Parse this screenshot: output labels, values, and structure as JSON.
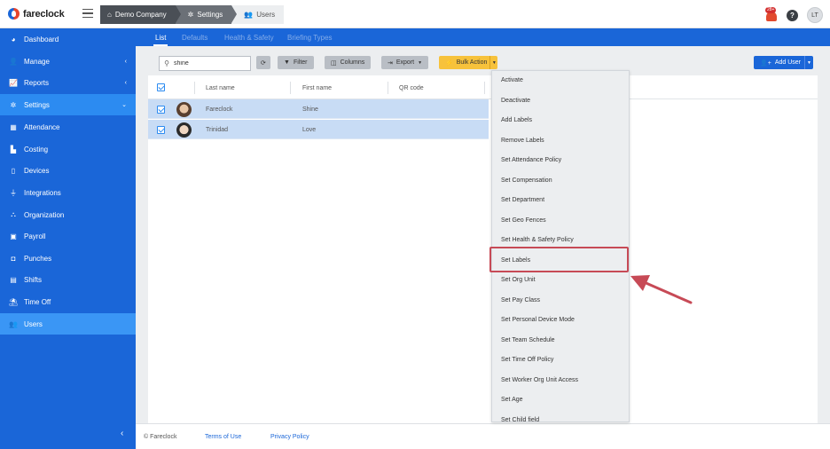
{
  "app": {
    "logo_text": "fareclock"
  },
  "breadcrumb": [
    {
      "label": "Demo Company",
      "icon": "home-icon"
    },
    {
      "label": "Settings",
      "icon": "gear-icon"
    },
    {
      "label": "Users",
      "icon": "users-icon"
    }
  ],
  "header": {
    "notifications_badge": "28+",
    "help_label": "?",
    "avatar_initials": "LT"
  },
  "sidebar": {
    "items": [
      {
        "label": "Dashboard",
        "icon": "dashboard-icon"
      },
      {
        "label": "Manage",
        "icon": "user-icon"
      },
      {
        "label": "Reports",
        "icon": "chart-icon"
      },
      {
        "label": "Settings",
        "icon": "gear-icon"
      },
      {
        "label": "Attendance",
        "icon": "attendance-icon"
      },
      {
        "label": "Costing",
        "icon": "costing-icon"
      },
      {
        "label": "Devices",
        "icon": "device-icon"
      },
      {
        "label": "Integrations",
        "icon": "plug-icon"
      },
      {
        "label": "Organization",
        "icon": "org-icon"
      },
      {
        "label": "Payroll",
        "icon": "payroll-icon"
      },
      {
        "label": "Punches",
        "icon": "punch-icon"
      },
      {
        "label": "Shifts",
        "icon": "calendar-icon"
      },
      {
        "label": "Time Off",
        "icon": "beach-icon"
      },
      {
        "label": "Users",
        "icon": "users-icon"
      }
    ],
    "collapse_glyph": "‹"
  },
  "tabs": [
    "List",
    "Defaults",
    "Health & Safety",
    "Briefing Types"
  ],
  "toolbar": {
    "search_value": "shine",
    "filter_label": "Filter",
    "columns_label": "Columns",
    "export_label": "Export",
    "bulk_action_label": "Bulk Action",
    "add_user_label": "Add User"
  },
  "table": {
    "headers": [
      "Last name",
      "First name",
      "QR code"
    ],
    "rows": [
      {
        "last_name": "Fareclock",
        "first_name": "Shine"
      },
      {
        "last_name": "Trinidad",
        "first_name": "Love"
      }
    ]
  },
  "bulk_menu": {
    "items": [
      "Activate",
      "Deactivate",
      "Add Labels",
      "Remove Labels",
      "Set Attendance Policy",
      "Set Compensation",
      "Set Department",
      "Set Geo Fences",
      "Set Health & Safety Policy",
      "Set Labels",
      "Set Org Unit",
      "Set Pay Class",
      "Set Personal Device Mode",
      "Set Team Schedule",
      "Set Time Off Policy",
      "Set Worker Org Unit Access",
      "Set Age",
      "Set Child field"
    ],
    "highlighted": "Set Labels"
  },
  "footer": {
    "copyright": "© Fareclock",
    "terms": "Terms of Use",
    "privacy": "Privacy Policy"
  },
  "colors": {
    "sidebar": "#1a66d8",
    "accent": "#2c8bf1",
    "bulk": "#f7c23b",
    "highlight": "#c74a56"
  }
}
